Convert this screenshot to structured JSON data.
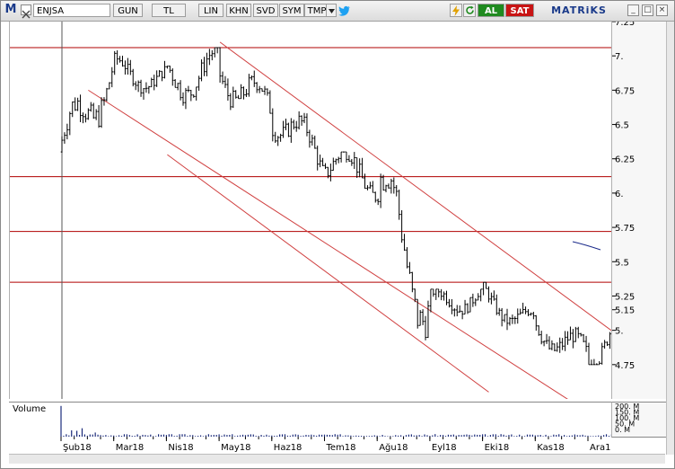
{
  "toolbar": {
    "logo": "M",
    "symbol": "ENJSA",
    "buttons": [
      "GUN",
      "TL",
      "LIN",
      "KHN",
      "SVD",
      "SYM",
      "TMP"
    ],
    "buy_label": "AL",
    "sell_label": "SAT",
    "brand": "MATRiKS",
    "icon_names": [
      "close-icon",
      "dropdown-arrow-icon",
      "twitter-icon",
      "lightning-icon",
      "refresh-icon",
      "minimize-icon",
      "maximize-icon",
      "close-window-icon"
    ]
  },
  "volume_panel": {
    "label": "Volume",
    "axis_labels": [
      "200. M",
      "150. M",
      "100. M",
      "50. M",
      "0. M"
    ]
  },
  "chart_data": {
    "type": "candlestick",
    "symbol": "ENJSA",
    "period": "GUN",
    "currency": "TL",
    "y_ticks": [
      "7.25",
      "7.",
      "6.75",
      "6.5",
      "6.25",
      "6.",
      "5.75",
      "5.5",
      "5.25",
      "5.15",
      "5.",
      "4.75"
    ],
    "ylim": [
      4.5,
      7.25
    ],
    "x_ticks": [
      "Şub18",
      "Mar18",
      "Nis18",
      "May18",
      "Haz18",
      "Tem18",
      "Ağu18",
      "Eyl18",
      "Eki18",
      "Kas18",
      "Ara18"
    ],
    "x_tick_positions": [
      0,
      1,
      2,
      3,
      4,
      5,
      6,
      7,
      8,
      9,
      10
    ],
    "horizontal_levels": [
      7.06,
      6.12,
      5.72,
      5.35
    ],
    "price_path_monthly": [
      {
        "month": "Şub18",
        "open": 6.3,
        "high": 6.98,
        "low": 6.1,
        "close": 6.9
      },
      {
        "month": "Mar18",
        "open": 6.9,
        "high": 7.06,
        "low": 6.65,
        "close": 6.82
      },
      {
        "month": "Nis18",
        "open": 6.82,
        "high": 7.06,
        "low": 6.4,
        "close": 6.9
      },
      {
        "month": "May18",
        "open": 6.9,
        "high": 7.1,
        "low": 6.45,
        "close": 6.6
      },
      {
        "month": "Haz18",
        "open": 6.6,
        "high": 6.7,
        "low": 6.1,
        "close": 6.25
      },
      {
        "month": "Tem18",
        "open": 6.25,
        "high": 6.3,
        "low": 5.7,
        "close": 6.1
      },
      {
        "month": "Ağu18",
        "open": 6.1,
        "high": 6.2,
        "low": 4.85,
        "close": 5.2
      },
      {
        "month": "Eyl18",
        "open": 5.2,
        "high": 5.3,
        "low": 4.9,
        "close": 5.25
      },
      {
        "month": "Eki18",
        "open": 5.25,
        "high": 5.35,
        "low": 4.95,
        "close": 5.05
      },
      {
        "month": "Kas18",
        "open": 5.05,
        "high": 5.2,
        "low": 4.68,
        "close": 4.8
      },
      {
        "month": "Ara18",
        "open": 4.8,
        "high": 5.25,
        "low": 4.75,
        "close": 5.15
      }
    ],
    "trend_channel": {
      "upper": [
        {
          "x": 3.0,
          "y": 7.1
        },
        {
          "x": 10.6,
          "y": 4.95
        }
      ],
      "middle": [
        {
          "x": 0.5,
          "y": 6.75
        },
        {
          "x": 10.6,
          "y": 4.25
        }
      ],
      "lower_extension": [
        {
          "x": 2.0,
          "y": 6.28
        },
        {
          "x": 8.1,
          "y": 4.55
        }
      ]
    },
    "volume_ylim": [
      0,
      200
    ],
    "volume_unit": "M"
  }
}
